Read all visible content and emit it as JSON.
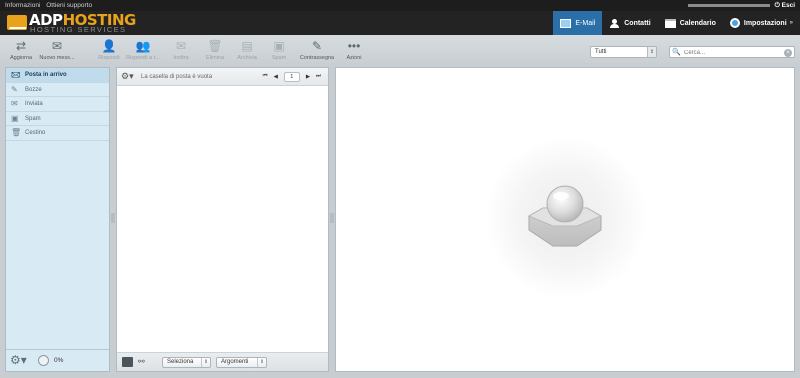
{
  "topbar": {
    "links": [
      "Informazioni",
      "Ottieni supporto"
    ],
    "logout_label": "Esci"
  },
  "brand": {
    "name_main": "ADP",
    "name_accent": "HOSTING",
    "tagline": "HOSTING SERVICES",
    "accent_color": "#e8a21c"
  },
  "nav": {
    "items": [
      {
        "label": "E-Mail",
        "icon": "mail-icon",
        "active": true
      },
      {
        "label": "Contatti",
        "icon": "contacts-icon"
      },
      {
        "label": "Calendario",
        "icon": "calendar-icon"
      },
      {
        "label": "Impostazioni",
        "icon": "settings-icon"
      }
    ],
    "active_color": "#2a6fa8"
  },
  "toolbar": {
    "buttons": [
      {
        "label": "Aggiorna",
        "icon": "refresh-icon",
        "enabled": true
      },
      {
        "label": "Nuovo mess...",
        "icon": "compose-icon",
        "enabled": true
      },
      {
        "label": "Rispondi",
        "icon": "reply-icon",
        "enabled": false
      },
      {
        "label": "Rispondi a t...",
        "icon": "reply-all-icon",
        "enabled": false
      },
      {
        "label": "Inoltra",
        "icon": "forward-icon",
        "enabled": false
      },
      {
        "label": "Elimina",
        "icon": "trash-icon",
        "enabled": false
      },
      {
        "label": "Archivia",
        "icon": "archive-icon",
        "enabled": false
      },
      {
        "label": "Spam",
        "icon": "spam-icon",
        "enabled": false
      },
      {
        "label": "Contrassegna",
        "icon": "mark-icon",
        "enabled": true
      },
      {
        "label": "Azioni",
        "icon": "more-icon",
        "enabled": true
      }
    ]
  },
  "filter": {
    "selected": "Tutti"
  },
  "search": {
    "placeholder": "Cerca..."
  },
  "folders": {
    "items": [
      {
        "label": "Posta in arrivo",
        "icon": "inbox-icon",
        "active": true
      },
      {
        "label": "Bozze",
        "icon": "drafts-icon"
      },
      {
        "label": "Inviata",
        "icon": "sent-icon"
      },
      {
        "label": "Spam",
        "icon": "spam-folder-icon"
      },
      {
        "label": "Cestino",
        "icon": "trash-folder-icon"
      }
    ],
    "quota": "0%"
  },
  "messagelist": {
    "empty_text": "La casella di posta è vuota",
    "page": "1",
    "select_label": "Seleziona",
    "threads_label": "Argomenti"
  }
}
